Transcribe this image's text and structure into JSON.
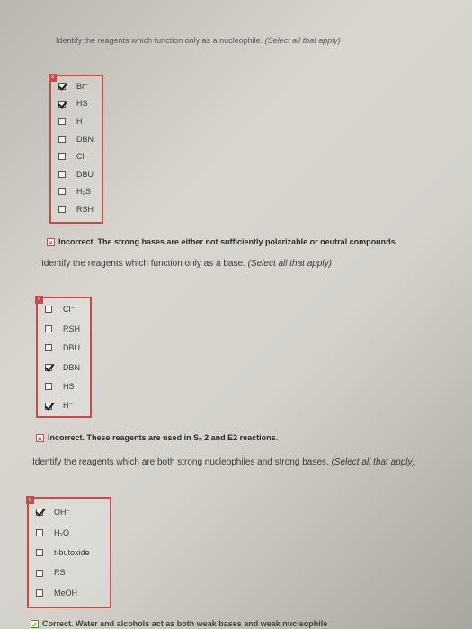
{
  "q1": {
    "text": "Identify the reagents which function only as a nucleophile.",
    "hint": "(Select all that apply)",
    "options": [
      {
        "label": "Br⁻",
        "checked": true
      },
      {
        "label": "HS⁻",
        "checked": true
      },
      {
        "label": "H⁻",
        "checked": false
      },
      {
        "label": "DBN",
        "checked": false
      },
      {
        "label": "Cl⁻",
        "checked": false
      },
      {
        "label": "DBU",
        "checked": false
      },
      {
        "label": "H₂S",
        "checked": false
      },
      {
        "label": "RSH",
        "checked": false
      }
    ],
    "feedback": "Incorrect. The strong bases are either not sufficiently polarizable or neutral compounds."
  },
  "q2": {
    "text": "Identify the reagents which function only as a base.",
    "hint": "(Select all that apply)",
    "options": [
      {
        "label": "Cl⁻",
        "checked": false
      },
      {
        "label": "RSH",
        "checked": false
      },
      {
        "label": "DBU",
        "checked": false
      },
      {
        "label": "DBN",
        "checked": true
      },
      {
        "label": "HS⁻",
        "checked": false
      },
      {
        "label": "H⁻",
        "checked": true
      }
    ],
    "feedback": "Incorrect. These reagents are used in Sₙ 2 and E2 reactions."
  },
  "q3": {
    "text": "Identify the reagents which are both strong nucleophiles and strong bases.",
    "hint": "(Select all that apply)",
    "options": [
      {
        "label": "OH⁻",
        "checked": true
      },
      {
        "label": "H₂O",
        "checked": false
      },
      {
        "label": "t-butoxide",
        "checked": false
      },
      {
        "label": "RS⁻",
        "checked": false
      },
      {
        "label": "MeOH",
        "checked": false
      }
    ],
    "feedback": "Correct. Water and alcohols act as both weak bases and weak nucleophile"
  },
  "icons": {
    "incorrect": "x-icon",
    "correct": "check-icon"
  }
}
